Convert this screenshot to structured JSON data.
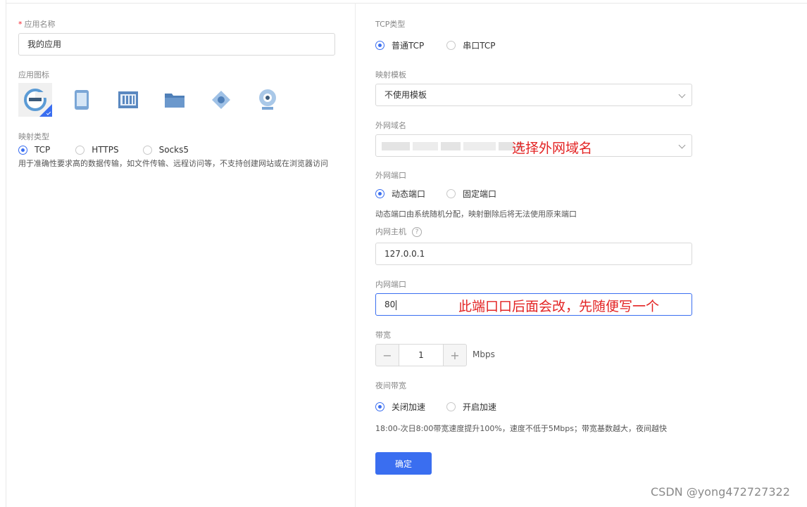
{
  "left": {
    "app_name": {
      "required_mark": "*",
      "label": "应用名称",
      "value": "我的应用"
    },
    "app_icon": {
      "label": "应用图标",
      "icons": [
        "ie-browser-icon",
        "phone-icon",
        "server-icon",
        "folder-icon",
        "network-icon",
        "webcam-icon"
      ]
    },
    "map_type": {
      "label": "映射类型",
      "options": [
        "TCP",
        "HTTPS",
        "Socks5"
      ],
      "selected": "TCP",
      "hint": "用于准确性要求高的数据传输，如文件传输、远程访问等，不支持创建网站或在浏览器访问"
    }
  },
  "right": {
    "tcp_type": {
      "label": "TCP类型",
      "options": [
        "普通TCP",
        "串口TCP"
      ],
      "selected": "普通TCP"
    },
    "template": {
      "label": "映射模板",
      "value": "不使用模板"
    },
    "domain": {
      "label": "外网域名",
      "annotation": "选择外网域名"
    },
    "external_port": {
      "label": "外网端口",
      "options": [
        "动态端口",
        "固定端口"
      ],
      "selected": "动态端口",
      "hint": "动态端口由系统随机分配，映射删除后将无法使用原来端口"
    },
    "internal_host": {
      "label": "内网主机",
      "help": "?",
      "value": "127.0.0.1"
    },
    "internal_port": {
      "label": "内网端口",
      "value": "80",
      "annotation": "此端口口后面会改，先随便写一个"
    },
    "bandwidth": {
      "label": "带宽",
      "minus": "−",
      "value": "1",
      "plus": "+",
      "unit": "Mbps"
    },
    "night_bandwidth": {
      "label": "夜间带宽",
      "options": [
        "关闭加速",
        "开启加速"
      ],
      "selected": "关闭加速",
      "hint": "18:00-次日8:00带宽速度提升100%，速度不低于5Mbps；带宽基数越大，夜间越快"
    },
    "submit_label": "确定"
  },
  "watermark": "CSDN @yong472727322",
  "colors": {
    "accent": "#3a6ef0",
    "annotation": "#e32323"
  }
}
